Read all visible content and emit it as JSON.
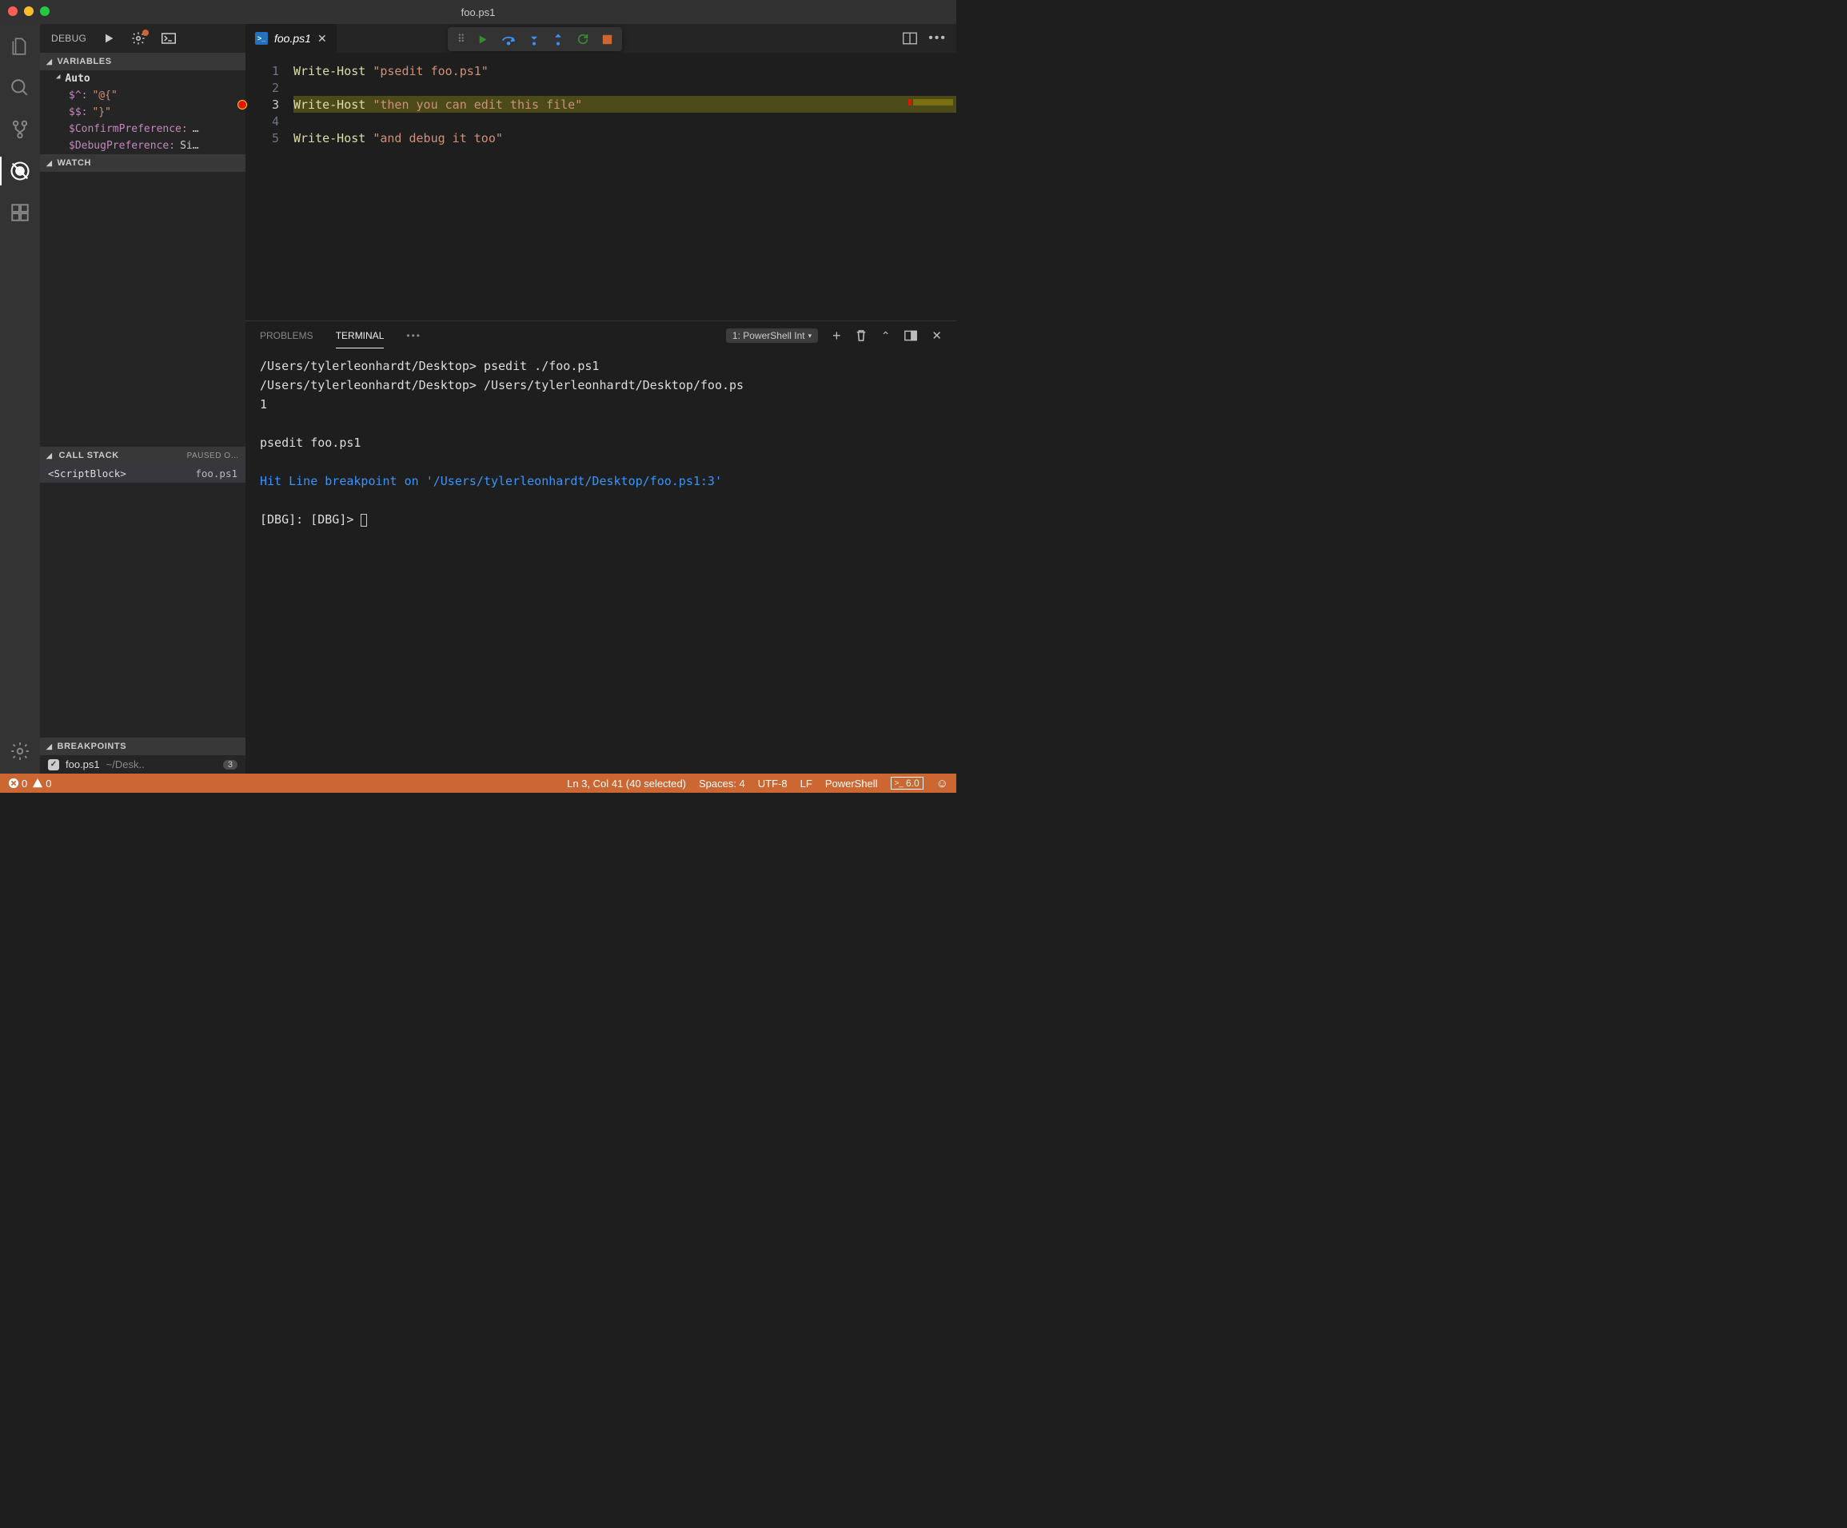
{
  "title": "foo.ps1",
  "activity_icons": [
    "explorer",
    "search",
    "scm",
    "debug",
    "extensions",
    "settings"
  ],
  "side": {
    "debug_label": "DEBUG",
    "sections": {
      "variables": "VARIABLES",
      "watch": "WATCH",
      "callstack": "CALL STACK",
      "callstack_aux": "PAUSED O…",
      "breakpoints": "BREAKPOINTS"
    },
    "auto_label": "Auto",
    "vars": [
      {
        "name": "$^:",
        "value": "\"@{\""
      },
      {
        "name": "$$:",
        "value": "\"}\""
      },
      {
        "name": "$ConfirmPreference:",
        "value": "…"
      },
      {
        "name": "$DebugPreference:",
        "value": "Si…"
      }
    ],
    "callstack": {
      "name": "<ScriptBlock>",
      "file": "foo.ps1"
    },
    "breakpoint": {
      "file": "foo.ps1",
      "path": "~/Desk..",
      "line": "3"
    }
  },
  "tab": {
    "file": "foo.ps1"
  },
  "code": {
    "lines": [
      {
        "n": "1",
        "cmd": "Write-Host ",
        "str": "\"psedit foo.ps1\""
      },
      {
        "n": "2",
        "cmd": "",
        "str": ""
      },
      {
        "n": "3",
        "cmd": "Write-Host ",
        "str": "\"then you can edit this file\""
      },
      {
        "n": "4",
        "cmd": "",
        "str": ""
      },
      {
        "n": "5",
        "cmd": "Write-Host ",
        "str": "\"and debug it too\""
      }
    ]
  },
  "panel": {
    "tabs": {
      "problems": "PROBLEMS",
      "terminal": "TERMINAL"
    },
    "selector": "1: PowerShell Int",
    "terminal": {
      "l1": "/Users/tylerleonhardt/Desktop> psedit ./foo.ps1",
      "l2": "/Users/tylerleonhardt/Desktop> /Users/tylerleonhardt/Desktop/foo.ps1",
      "l3": "psedit foo.ps1",
      "hit": "Hit Line breakpoint on '/Users/tylerleonhardt/Desktop/foo.ps1:3'",
      "dbg": "[DBG]:  [DBG]> "
    }
  },
  "status": {
    "errors": "0",
    "warnings": "0",
    "pos": "Ln 3, Col 41 (40 selected)",
    "spaces": "Spaces: 4",
    "enc": "UTF-8",
    "eol": "LF",
    "lang": "PowerShell",
    "psver": "6.0"
  }
}
